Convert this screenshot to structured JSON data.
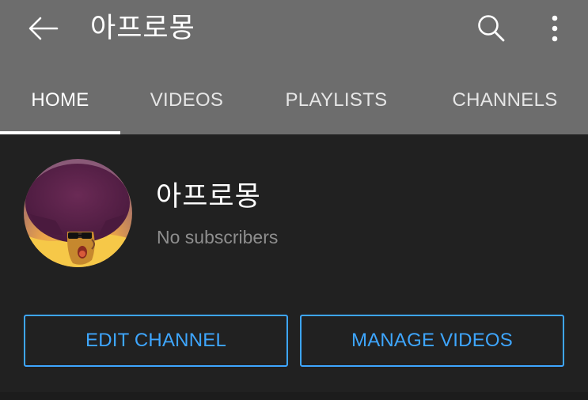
{
  "header": {
    "back_icon": "arrow-left-icon",
    "title": "아프로몽",
    "search_icon": "search-icon",
    "more_icon": "more-vertical-icon",
    "background_color": "#6d6d6d"
  },
  "tabs": [
    {
      "label": "HOME",
      "active": true
    },
    {
      "label": "VIDEOS",
      "active": false
    },
    {
      "label": "PLAYLISTS",
      "active": false
    },
    {
      "label": "CHANNELS",
      "active": false
    }
  ],
  "channel": {
    "name": "아프로몽",
    "subscribers": "No subscribers",
    "avatar_icon": "afro-character-avatar"
  },
  "actions": {
    "edit_label": "EDIT CHANNEL",
    "manage_label": "MANAGE VIDEOS",
    "accent_color": "#3ea6ff"
  },
  "theme": {
    "background": "#212121",
    "text_primary": "#ffffff",
    "text_secondary": "#8e8e8e"
  }
}
